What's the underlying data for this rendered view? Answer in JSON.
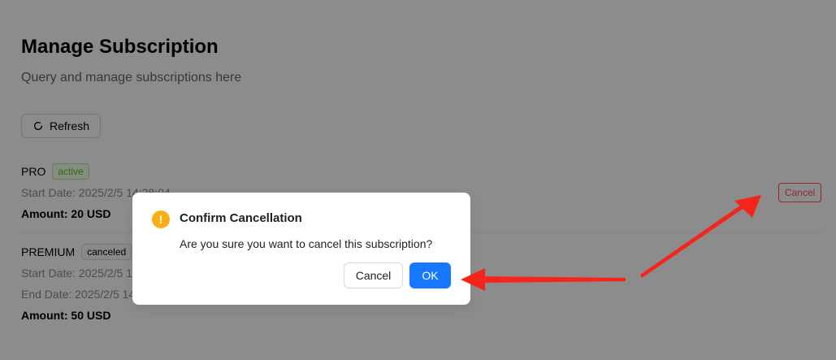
{
  "page": {
    "title": "Manage Subscription",
    "subtitle": "Query and manage subscriptions here",
    "refresh_label": "Refresh"
  },
  "subscriptions": [
    {
      "plan": "PRO",
      "status": "active",
      "start_date": "Start Date: 2025/2/5 14:28:04",
      "amount": "Amount: 20 USD",
      "cancel_label": "Cancel"
    },
    {
      "plan": "PREMIUM",
      "status": "canceled",
      "start_date": "Start Date: 2025/2/5 14:",
      "end_date": "End Date: 2025/2/5 14:",
      "amount": "Amount: 50 USD"
    }
  ],
  "modal": {
    "icon": "exclamation-icon",
    "icon_glyph": "!",
    "title": "Confirm Cancellation",
    "content": "Are you sure you want to cancel this subscription?",
    "cancel_label": "Cancel",
    "ok_label": "OK"
  },
  "colors": {
    "primary": "#1677ff",
    "danger": "#ff4d4f",
    "warning": "#faad14",
    "success": "#52c41a",
    "annotation_arrow": "#f5251c"
  }
}
